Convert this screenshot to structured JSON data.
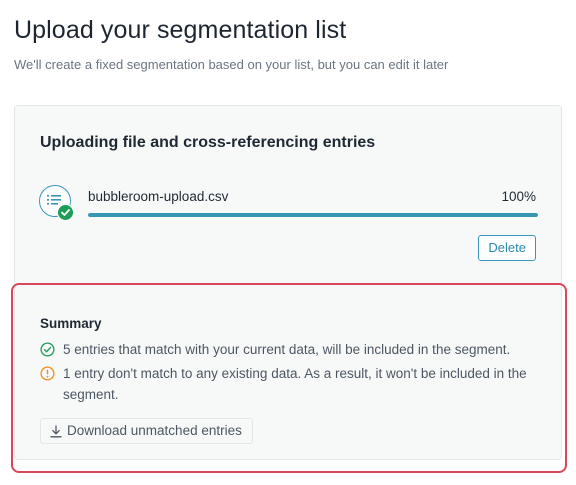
{
  "header": {
    "title": "Upload your segmentation list",
    "subtitle": "We'll create a fixed segmentation based on your list, but you can edit it later"
  },
  "upload": {
    "title": "Uploading file and cross-referencing entries",
    "file_name": "bubbleroom-upload.csv",
    "progress_label": "100%",
    "progress_fraction": 1.0,
    "delete_label": "Delete",
    "icons": {
      "file": "file-list-icon",
      "status": "check-circle-icon"
    },
    "colors": {
      "accent": "#3597b3",
      "success": "#1e9c5a"
    }
  },
  "summary": {
    "title": "Summary",
    "matched_text": "5 entries that match with your current data, will be included in the segment.",
    "unmatched_text": "1 entry don't match to any existing data. As a result, it won't be included in the segment.",
    "download_label": "Download unmatched entries",
    "icons": {
      "matched": "check-circle-outline-icon",
      "unmatched": "warning-circle-icon",
      "download": "download-icon"
    },
    "colors": {
      "success": "#1e9c5a",
      "warning": "#f08c1c",
      "highlight_border": "#d9475a"
    }
  }
}
